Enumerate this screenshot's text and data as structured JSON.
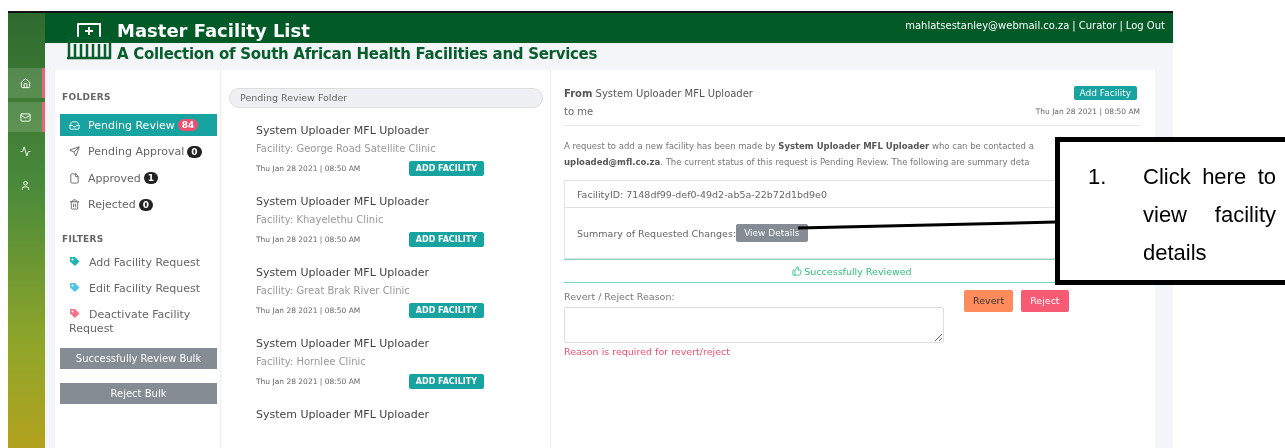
{
  "header": {
    "title": "Master Facility List",
    "subtitle": "A Collection of South African Health Facilities and Services",
    "user_email": "mahlatsestanley@webmail.co.za",
    "role": "Curator",
    "logout": "Log Out",
    "separator": "|"
  },
  "rail": [
    {
      "selected": true
    },
    {
      "selected": true
    },
    {
      "selected": false
    },
    {
      "selected": false
    }
  ],
  "folders": {
    "heading": "FOLDERS",
    "items": [
      {
        "label": "Pending Review",
        "count": "84",
        "selected": true
      },
      {
        "label": "Pending Approval",
        "count": "0",
        "selected": false
      },
      {
        "label": "Approved",
        "count": "1",
        "selected": false
      },
      {
        "label": "Rejected",
        "count": "0",
        "selected": false
      }
    ]
  },
  "filters": {
    "heading": "FILTERS",
    "items": [
      {
        "label": "Add Facility Request",
        "color": "#1fb5b0"
      },
      {
        "label": "Edit Facility Request",
        "color": "#4fc3e8"
      },
      {
        "label": "Deactivate Facility Request",
        "color": "#f4758a"
      }
    ]
  },
  "bulk_buttons": [
    "Successfully Review Bulk",
    "Reject Bulk"
  ],
  "search": {
    "placeholder": "Pending Review Folder"
  },
  "messages": [
    {
      "sender": "System Uploader MFL Uploader",
      "facility": "Facility: George Road Satellite Clinic",
      "date": "Thu Jan 28 2021 | 08:50 AM",
      "action": "ADD FACILITY"
    },
    {
      "sender": "System Uploader MFL Uploader",
      "facility": "Facility: Khayelethu Clinic",
      "date": "Thu Jan 28 2021 | 08:50 AM",
      "action": "ADD FACILITY"
    },
    {
      "sender": "System Uploader MFL Uploader",
      "facility": "Facility: Great Brak River Clinic",
      "date": "Thu Jan 28 2021 | 08:50 AM",
      "action": "ADD FACILITY"
    },
    {
      "sender": "System Uploader MFL Uploader",
      "facility": "Facility: Hornlee Clinic",
      "date": "Thu Jan 28 2021 | 08:50 AM",
      "action": "ADD FACILITY"
    },
    {
      "sender": "System Uploader MFL Uploader"
    }
  ],
  "detail": {
    "from": "**From** System Uploader MFL Uploader",
    "to": "to me",
    "tag": "Add Facility",
    "date": "Thu Jan 28 2021 | 08:50 AM",
    "body_lines": [
      "A request to add a new facility has been made by **System Uploader MFL Uploader** who can be contacted a",
      "**uploaded@mfl.co.za**. The current status of this request is Pending Review. The following are summary deta"
    ],
    "facility_id": "FacilityID: 7148df99-def0-49d2-ab5a-22b72d1bd9e0",
    "summary_label": "Summary of Requested Changes:",
    "view_button": "View Details",
    "status": "Successfully Reviewed",
    "reason_label": "Revert / Reject Reason:",
    "reason_error": "Reason is required for revert/reject",
    "revert_button": "Revert",
    "reject_button": "Reject"
  },
  "callout": {
    "number": "1.",
    "text": "Click here to view facility details"
  }
}
